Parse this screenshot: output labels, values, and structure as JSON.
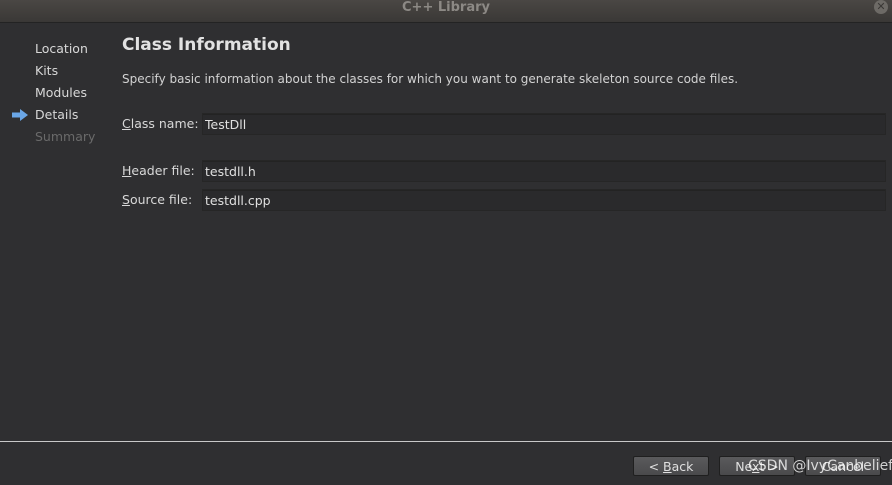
{
  "window": {
    "title": "C++ Library"
  },
  "sidebar": {
    "steps": [
      {
        "label": "Location",
        "state": "done"
      },
      {
        "label": "Kits",
        "state": "done"
      },
      {
        "label": "Modules",
        "state": "done"
      },
      {
        "label": "Details",
        "state": "current"
      },
      {
        "label": "Summary",
        "state": "disabled"
      }
    ],
    "current_indicator": "arrow-right-icon"
  },
  "main": {
    "title": "Class Information",
    "description": "Specify basic information about the classes for which you want to generate skeleton source code files.",
    "fields": {
      "class_name": {
        "mnemonic": "C",
        "label_rest": "lass name:",
        "value": "TestDll"
      },
      "header_file": {
        "mnemonic": "H",
        "label_rest": "eader file:",
        "value": "testdll.h"
      },
      "source_file": {
        "mnemonic": "S",
        "label_rest": "ource file:",
        "value": "testdll.cpp"
      }
    }
  },
  "buttons": {
    "back": {
      "prefix": "< ",
      "mnemonic": "B",
      "rest": "ack"
    },
    "next": {
      "prefix": "Ne",
      "mnemonic": "x",
      "rest": "t >"
    },
    "cancel": {
      "label": "Cancel"
    }
  },
  "watermark": "CSDN @IvyCanbelief",
  "colors": {
    "background": "#2f2f31",
    "accent_arrow": "#6aa6e6",
    "separator": "#c9c9c9"
  }
}
